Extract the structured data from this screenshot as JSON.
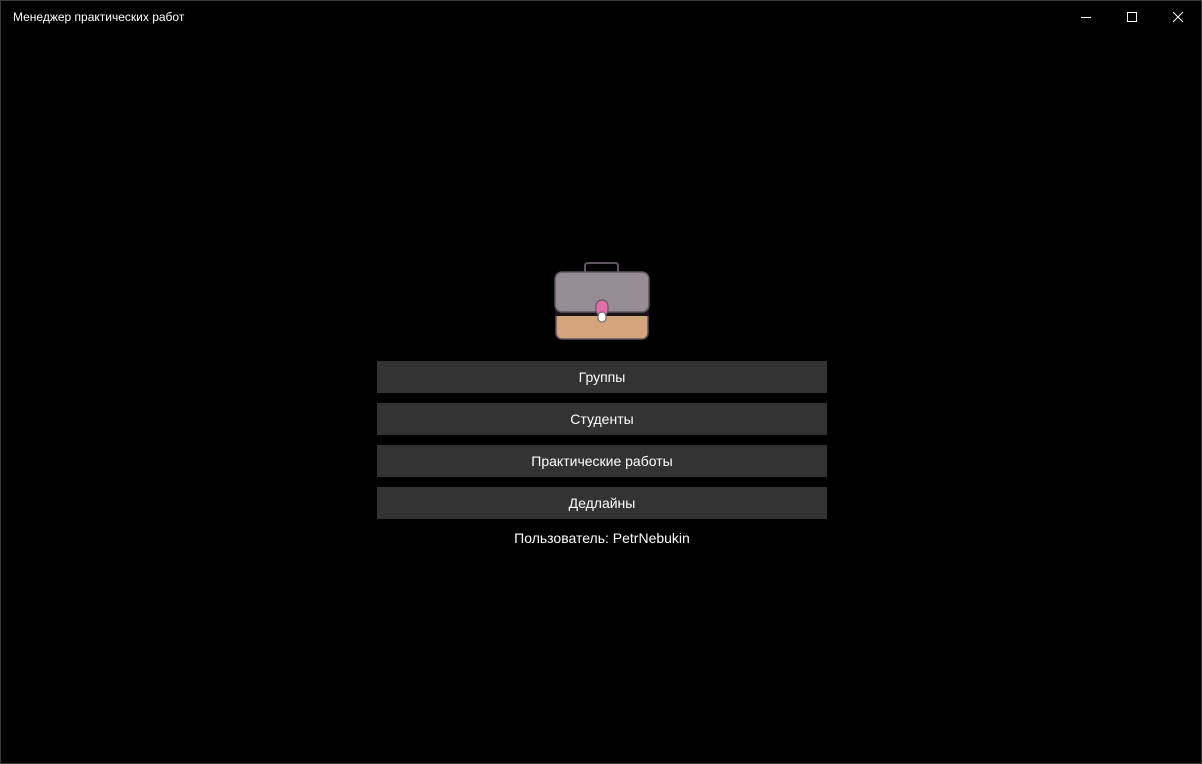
{
  "window": {
    "title": "Менеджер практических работ",
    "controls": [
      "minimize-icon",
      "maximize-icon",
      "close-icon"
    ]
  },
  "logo": {
    "icon": "briefcase-icon",
    "colors": {
      "lid": "#968c94",
      "body": "#d4a57c",
      "clasp": "#e46fa6",
      "outline": "#5f5560"
    }
  },
  "menu": {
    "groups": "Группы",
    "students": "Студенты",
    "practical_works": "Практические работы",
    "deadlines": "Дедлайны"
  },
  "user": {
    "label": "Пользователь: PetrNebukin"
  },
  "colors": {
    "background": "#000000",
    "button": "#333333",
    "text": "#ffffff"
  }
}
